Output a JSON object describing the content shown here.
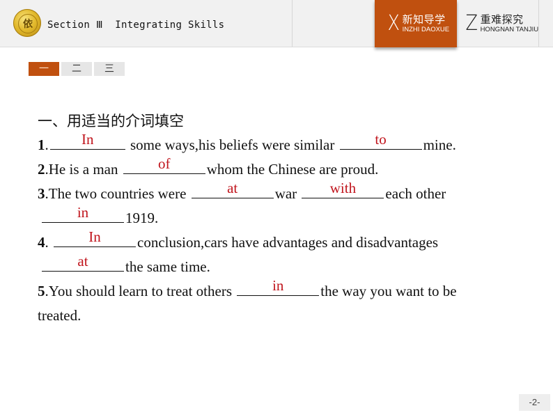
{
  "header": {
    "logo_icon": "school-emblem-icon",
    "logo_glyph": "依",
    "section_title": "Section Ⅲ  Integrating Skills",
    "nav": [
      {
        "letter": "X",
        "cn": "新知导学",
        "en": "INZHI DAOXUE",
        "active": true
      },
      {
        "letter": "Z",
        "cn": "重难探究",
        "en": "HONGNAN TANJIU",
        "active": false
      }
    ]
  },
  "tabs": [
    {
      "label": "一",
      "active": true
    },
    {
      "label": "二",
      "active": false
    },
    {
      "label": "三",
      "active": false
    }
  ],
  "content": {
    "heading": "一、用适当的介词填空",
    "q1": {
      "num": "1",
      "a1": "In",
      "t1": " some ways,his beliefs were similar ",
      "a2": "to",
      "t2": "mine."
    },
    "q2": {
      "num": "2",
      "t0": "He is a man ",
      "a1": "of",
      "t1": "whom the Chinese are proud."
    },
    "q3": {
      "num": "3",
      "t0": "The two countries were ",
      "a1": "at",
      "t1": "war ",
      "a2": "with",
      "t2": "each other",
      "a3": "in",
      "t3": "1919."
    },
    "q4": {
      "num": "4",
      "t0": " ",
      "a1": "In",
      "t1": "conclusion,cars have advantages and disadvantages",
      "a2": "at",
      "t2": "the same time."
    },
    "q5": {
      "num": "5",
      "t0": "You should learn to treat others ",
      "a1": "in",
      "t1": "the way you want to be",
      "t2": "treated."
    }
  },
  "colors": {
    "accent": "#c0500f",
    "answer": "#c0141c"
  },
  "footer": {
    "page_number": "-2-"
  }
}
